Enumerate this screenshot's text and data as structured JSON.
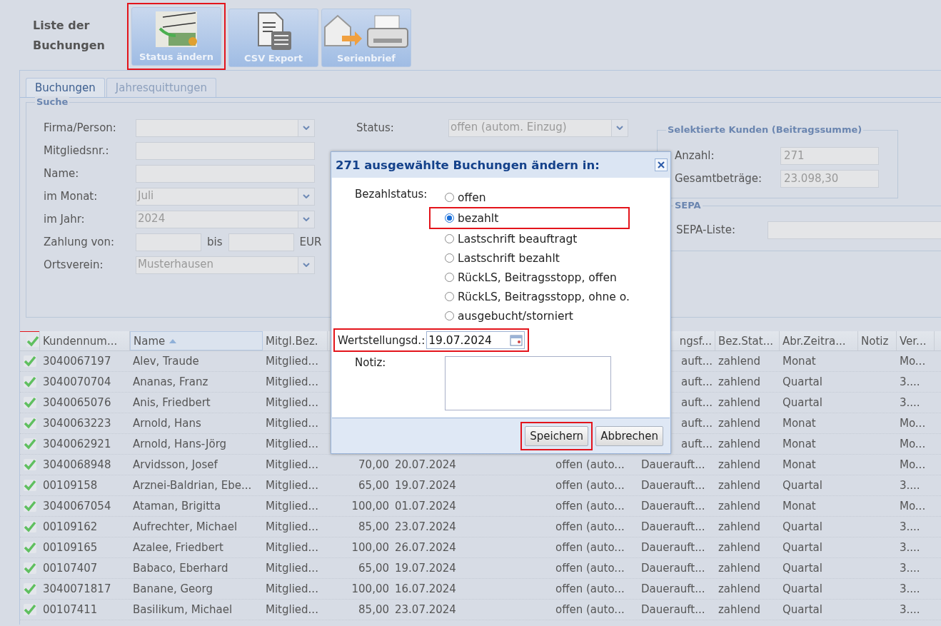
{
  "page_title": "Liste der Buchungen",
  "toolbar": [
    {
      "label": "Status ändern",
      "kind": "status",
      "highlighted": true
    },
    {
      "label": "CSV Export",
      "kind": "csv",
      "highlighted": false
    },
    {
      "label": "Serienbrief",
      "kind": "letter",
      "highlighted": false
    }
  ],
  "tabs": [
    {
      "label": "Buchungen",
      "selected": true
    },
    {
      "label": "Jahresquittungen",
      "selected": false
    }
  ],
  "search": {
    "legend": "Suche",
    "fields": [
      {
        "label": "Firma/Person:",
        "kind": "combo"
      },
      {
        "label": "Mitgliedsnr.:",
        "kind": "text"
      },
      {
        "label": "Name:",
        "kind": "text"
      },
      {
        "label": "im Monat:",
        "kind": "combo",
        "value": "Juli"
      },
      {
        "label": "im Jahr:",
        "kind": "combo",
        "value": "2024"
      },
      {
        "label": "Zahlung von:",
        "kind": "range",
        "between": "bis",
        "unit": "EUR"
      },
      {
        "label": "Ortsverein:",
        "kind": "combo",
        "value": "Musterhausen"
      }
    ],
    "status": {
      "label": "Status:",
      "value": "offen (autom. Einzug)"
    }
  },
  "summary": {
    "legend": "Selektierte Kunden (Beitragssumme)",
    "rows": [
      {
        "label": "Anzahl:",
        "value": "271"
      },
      {
        "label": "Gesamtbeträge:",
        "value": "23.098,30"
      }
    ]
  },
  "sepa": {
    "legend": "SEPA",
    "label": "SEPA-Liste:"
  },
  "table": {
    "header_checked": true,
    "header_highlighted": true,
    "columns": [
      {
        "label": "Kundennum..."
      },
      {
        "label": "Name",
        "sorted": true
      },
      {
        "label": "Mitgl.Bez."
      },
      {},
      {},
      {},
      {},
      {
        "label": "ngsf...",
        "clipped": true
      },
      {
        "label": "Bez.Stat..."
      },
      {
        "label": "Abr.Zeitra..."
      },
      {
        "label": "Notiz"
      },
      {
        "label": "Ver..."
      }
    ],
    "rows": [
      {
        "checked": true,
        "cells": [
          "3040067197",
          "Alev, Traude",
          "Mitglied...",
          null,
          null,
          null,
          null,
          "auft...",
          "zahlend",
          "Monat",
          null,
          "Mo..."
        ]
      },
      {
        "checked": true,
        "cells": [
          "3040070704",
          "Ananas, Franz",
          "Mitglied...",
          null,
          null,
          null,
          null,
          "auft...",
          "zahlend",
          "Quartal",
          null,
          "3...."
        ]
      },
      {
        "checked": true,
        "cells": [
          "3040065076",
          "Anis, Friedbert",
          "Mitglied...",
          null,
          null,
          null,
          null,
          "auft...",
          "zahlend",
          "Quartal",
          null,
          "3...."
        ]
      },
      {
        "checked": true,
        "cells": [
          "3040063223",
          "Arnold, Hans",
          "Mitglied...",
          null,
          null,
          null,
          null,
          "auft...",
          "zahlend",
          "Monat",
          null,
          "Mo..."
        ]
      },
      {
        "checked": true,
        "cells": [
          "3040062921",
          "Arnold, Hans-Jörg",
          "Mitglied...",
          null,
          null,
          null,
          null,
          "auft...",
          "zahlend",
          "Monat",
          null,
          "Mo..."
        ]
      },
      {
        "checked": true,
        "cells": [
          "3040068948",
          "Arvidsson, Josef",
          "Mitglied...",
          "70,00",
          "20.07.2024",
          null,
          "offen (auto...",
          "Dauerauft...",
          "zahlend",
          "Monat",
          null,
          "Mo..."
        ]
      },
      {
        "checked": true,
        "cells": [
          "00109158",
          "Arznei-Baldrian, Ebe...",
          "Mitglied...",
          "65,00",
          "19.07.2024",
          null,
          "offen (auto...",
          "Dauerauft...",
          "zahlend",
          "Quartal",
          null,
          "3...."
        ]
      },
      {
        "checked": true,
        "cells": [
          "3040067054",
          "Ataman, Brigitta",
          "Mitglied...",
          "100,00",
          "01.07.2024",
          null,
          "offen (auto...",
          "Dauerauft...",
          "zahlend",
          "Monat",
          null,
          "Mo..."
        ]
      },
      {
        "checked": true,
        "cells": [
          "00109162",
          "Aufrechter, Michael",
          "Mitglied...",
          "85,00",
          "23.07.2024",
          null,
          "offen (auto...",
          "Dauerauft...",
          "zahlend",
          "Quartal",
          null,
          "3...."
        ]
      },
      {
        "checked": true,
        "cells": [
          "00109165",
          "Azalee, Friedbert",
          "Mitglied...",
          "100,00",
          "26.07.2024",
          null,
          "offen (auto...",
          "Dauerauft...",
          "zahlend",
          "Quartal",
          null,
          "3...."
        ]
      },
      {
        "checked": true,
        "cells": [
          "00107407",
          "Babaco, Eberhard",
          "Mitglied...",
          "65,00",
          "19.07.2024",
          null,
          "offen (auto...",
          "Dauerauft...",
          "zahlend",
          "Quartal",
          null,
          "3...."
        ]
      },
      {
        "checked": true,
        "cells": [
          "3040071817",
          "Banane, Georg",
          "Mitglied...",
          "100,00",
          "16.07.2024",
          null,
          "offen (auto...",
          "Dauerauft...",
          "zahlend",
          "Quartal",
          null,
          "3...."
        ]
      },
      {
        "checked": true,
        "cells": [
          "00107411",
          "Basilikum, Michael",
          "Mitglied...",
          "85,00",
          "23.07.2024",
          null,
          "offen (auto...",
          "Dauerauft...",
          "zahlend",
          "Quartal",
          null,
          "3...."
        ]
      }
    ]
  },
  "dialog": {
    "title": "271 ausgewählte Buchungen ändern in:",
    "status_label": "Bezahlstatus:",
    "options": [
      {
        "label": "offen",
        "selected": false,
        "highlighted": false
      },
      {
        "label": "bezahlt",
        "selected": true,
        "highlighted": true
      },
      {
        "label": "Lastschrift beauftragt",
        "selected": false,
        "highlighted": false
      },
      {
        "label": "Lastschrift bezahlt",
        "selected": false,
        "highlighted": false
      },
      {
        "label": "RückLS, Beitragsstopp, offen",
        "selected": false,
        "highlighted": false
      },
      {
        "label": "RückLS, Beitragsstopp, ohne o.",
        "selected": false,
        "highlighted": false
      },
      {
        "label": "ausgebucht/storniert",
        "selected": false,
        "highlighted": false
      }
    ],
    "date_label": "Wertstellungsd.:",
    "date_value": "19.07.2024",
    "date_highlighted": true,
    "note_label": "Notiz:",
    "buttons": [
      {
        "label": "Speichern",
        "highlighted": true
      },
      {
        "label": "Abbrechen",
        "highlighted": false
      }
    ]
  }
}
